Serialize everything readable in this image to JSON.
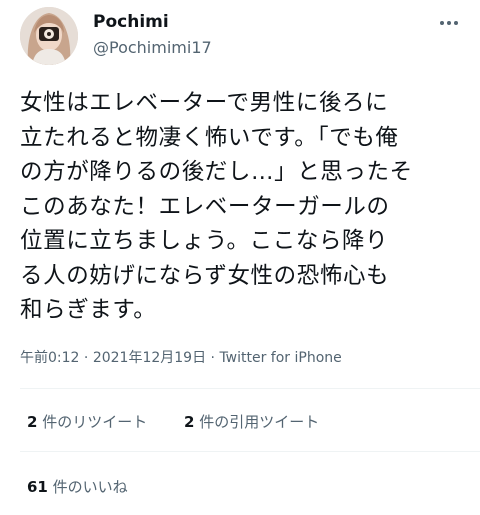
{
  "user": {
    "display_name": "Pochimi",
    "handle": "@Pochimimi17"
  },
  "tweet": {
    "lines": [
      "女性はエレベーターで男性に後ろに",
      "立たれると物凄く怖いです。「でも俺",
      "の方が降りるの後だし…」と思ったそ",
      "このあなた！エレベーターガールの",
      "位置に立ちましょう。ここなら降り",
      "る人の妨げにならず女性の恐怖心も",
      "和らぎます。"
    ]
  },
  "meta": {
    "time": "午前0:12",
    "separator": " · ",
    "date": "2021年12月19日",
    "source": "Twitter for iPhone"
  },
  "stats": {
    "retweets": {
      "count": "2",
      "label": " 件のリツイート"
    },
    "quotes": {
      "count": "2",
      "label": " 件の引用ツイート"
    },
    "likes": {
      "count": "61",
      "label": " 件のいいね"
    }
  },
  "icons": {
    "more": "more-horizontal-icon",
    "avatar": "avatar"
  }
}
